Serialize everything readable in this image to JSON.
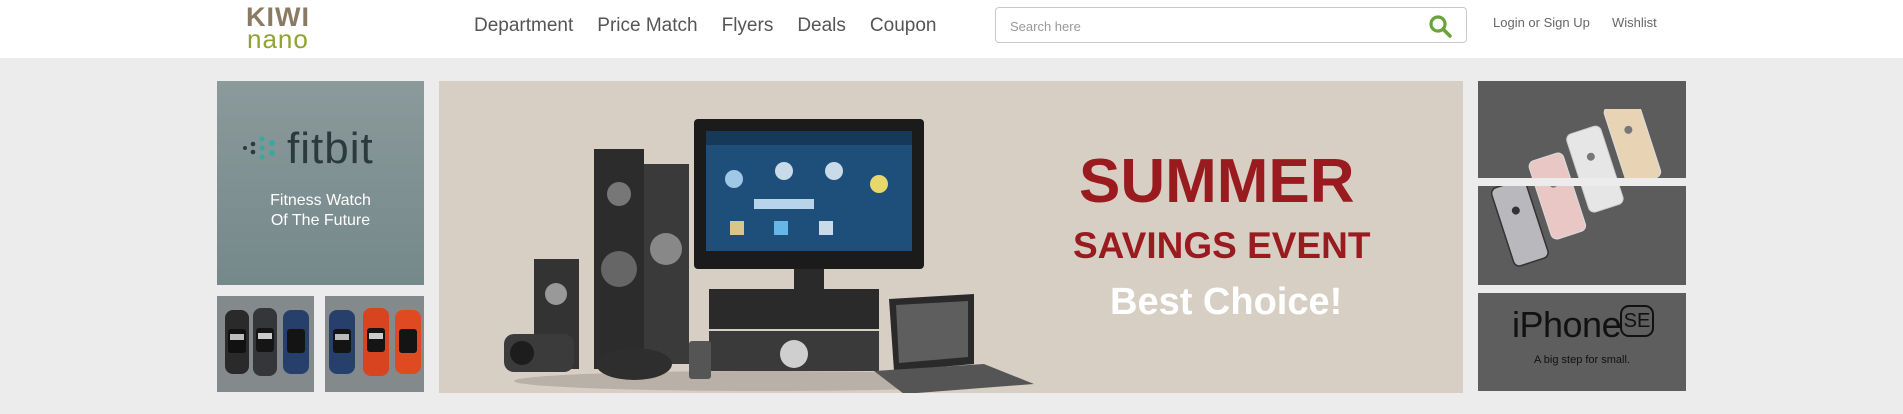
{
  "header": {
    "logo": {
      "line1": "KIWI",
      "line2": "nano"
    },
    "nav": [
      "Department",
      "Price Match",
      "Flyers",
      "Deals",
      "Coupon"
    ],
    "search": {
      "placeholder": "Search here",
      "value": ""
    },
    "login_label": "Login or Sign Up",
    "wishlist_label": "Wishlist"
  },
  "promos": {
    "fitbit": {
      "brand": "fitbit",
      "tagline_line1": "Fitness Watch",
      "tagline_line2": "Of The Future"
    },
    "hero": {
      "title": "SUMMER",
      "subtitle": "SAVINGS EVENT",
      "cta": "Best Choice!"
    },
    "iphone": {
      "brand": "iPhone",
      "badge": "SE",
      "tagline": "A big step for small."
    }
  },
  "colors": {
    "accent_green": "#6ba23a",
    "hero_red": "#9a1b1f",
    "hero_bg": "#d8cfc4",
    "page_bg": "#ececec"
  }
}
